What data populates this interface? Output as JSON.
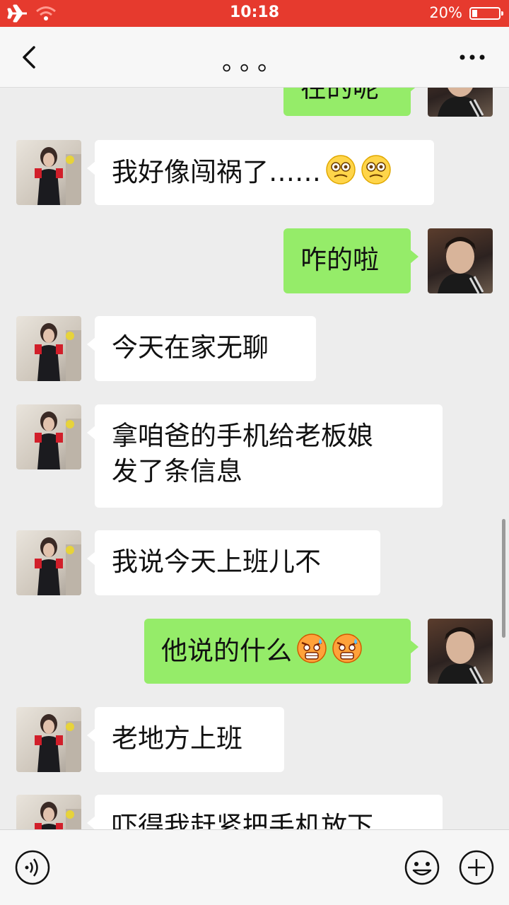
{
  "status_bar": {
    "time": "10:18",
    "battery_percent": "20%",
    "battery_level": 0.2,
    "background_color": "#e63a2e"
  },
  "nav": {
    "title": "。。。",
    "back_icon": "chevron-left-icon",
    "more_icon": "ellipsis-icon"
  },
  "chat": {
    "bubble_colors": {
      "incoming": "#ffffff",
      "outgoing": "#95ec69"
    },
    "messages": [
      {
        "side": "right",
        "text": "在的呢"
      },
      {
        "side": "left",
        "text": "我好像闯祸了……",
        "emojis": [
          "woozy-face-icon",
          "woozy-face-icon"
        ]
      },
      {
        "side": "right",
        "text": "咋的啦"
      },
      {
        "side": "left",
        "text": "今天在家无聊"
      },
      {
        "side": "left",
        "text_line1": "拿咱爸的手机给老板娘",
        "text_line2": "发了条信息"
      },
      {
        "side": "left",
        "text": "我说今天上班儿不"
      },
      {
        "side": "right",
        "text": "他说的什么",
        "emojis": [
          "angry-sweat-face-icon",
          "angry-sweat-face-icon"
        ]
      },
      {
        "side": "left",
        "text": "老地方上班"
      },
      {
        "side": "left",
        "text": "吓得我赶紧把手机放下"
      }
    ]
  },
  "input_bar": {
    "voice_icon": "voice-icon",
    "emoji_icon": "smiley-icon",
    "plus_icon": "plus-icon"
  }
}
